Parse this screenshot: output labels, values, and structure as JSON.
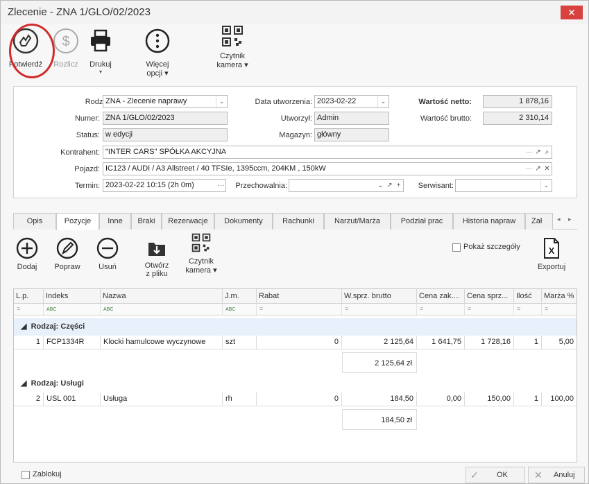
{
  "window": {
    "title": "Zlecenie - ZNA 1/GLO/02/2023",
    "close_glyph": "✕"
  },
  "toolbar": {
    "confirm": "Potwierdź",
    "settle": "Rozlicz",
    "print": "Drukuj",
    "more_line1": "Więcej",
    "more_line2": "opcji",
    "reader_line1": "Czytnik",
    "reader_line2": "kamera",
    "caret": "▾"
  },
  "form": {
    "rodzaj_label": "Rodzaj:",
    "rodzaj_value": "ZNA - Zlecenie naprawy",
    "numer_label": "Numer:",
    "numer_value": "ZNA 1/GLO/02/2023",
    "status_label": "Status:",
    "status_value": "w edycji",
    "data_label": "Data utworzenia:",
    "data_value": "2023-02-22",
    "utworzyl_label": "Utworzył:",
    "utworzyl_value": "Admin",
    "magazyn_label": "Magazyn:",
    "magazyn_value": "główny",
    "netto_label": "Wartość netto:",
    "netto_value": "1 878,16",
    "brutto_label": "Wartość brutto:",
    "brutto_value": "2 310,14",
    "kontrahent_label": "Kontrahent:",
    "kontrahent_value": "\"INTER CARS\" SPÓŁKA AKCYJNA",
    "pojazd_label": "Pojazd:",
    "pojazd_value": "IC123 / AUDI / A3 Allstreet / 40 TFSIe, 1395ccm, 204KM , 150kW",
    "termin_label": "Termin:",
    "termin_value": "2023-02-22 10:15 (2h 0m)",
    "przechowalnia_label": "Przechowalnia:",
    "przechowalnia_value": "",
    "serwisant_label": "Serwisant:",
    "serwisant_value": ""
  },
  "tabs": [
    "Opis",
    "Pozycje",
    "Inne",
    "Braki",
    "Rezerwacje",
    "Dokumenty",
    "Rachunki",
    "Narzut/Marża",
    "Podział prac",
    "Historia napraw",
    "Zał"
  ],
  "items_toolbar": {
    "add": "Dodaj",
    "edit": "Popraw",
    "remove": "Usuń",
    "open_line1": "Otwórz",
    "open_line2": "z pliku",
    "reader_line1": "Czytnik",
    "reader_line2": "kamera",
    "show_details": "Pokaż szczegóły",
    "export": "Exportuj"
  },
  "grid": {
    "columns": [
      "L.p.",
      "Indeks",
      "Nazwa",
      "J.m.",
      "Rabat",
      "W.sprz. brutto",
      "Cena zak....",
      "Cena sprz...",
      "Ilość",
      "Marża %"
    ],
    "filter_eq": "=",
    "filter_abc": "ABC",
    "groups": [
      {
        "label": "Rodzaj: Części",
        "rows": [
          {
            "lp": "1",
            "indeks": "FCP1334R",
            "nazwa": "Klocki hamulcowe wyczynowe",
            "jm": "szt",
            "rabat": "0",
            "wsprz": "2 125,64",
            "cena_zak": "1 641,75",
            "cena_sprz": "1 728,16",
            "ilosc": "1",
            "marza": "5,00"
          }
        ],
        "sum": "2 125,64 zł"
      },
      {
        "label": "Rodzaj: Usługi",
        "rows": [
          {
            "lp": "2",
            "indeks": "USL 001",
            "nazwa": "Usługa",
            "jm": "rh",
            "rabat": "0",
            "wsprz": "184,50",
            "cena_zak": "0,00",
            "cena_sprz": "150,00",
            "ilosc": "1",
            "marza": "100,00"
          }
        ],
        "sum": "184,50 zł"
      }
    ]
  },
  "footer": {
    "lock": "Zablokuj",
    "ok": "OK",
    "cancel": "Anuluj"
  }
}
